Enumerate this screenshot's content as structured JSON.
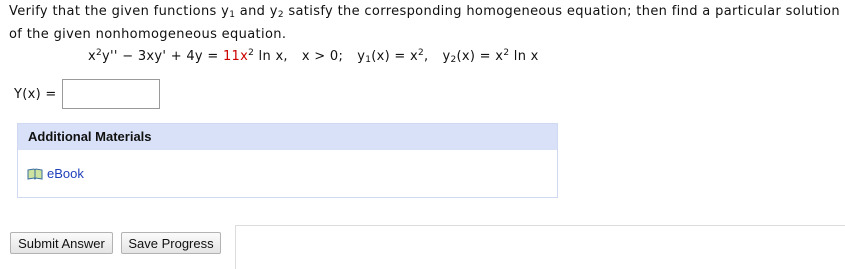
{
  "question": {
    "text_1": "Verify that the given functions ",
    "y1": "y",
    "y1_sub": "1",
    "text_and": " and ",
    "y2": "y",
    "y2_sub": "2",
    "text_2": " satisfy the corresponding homogeneous equation; then find a particular solution of the given nonhomogeneous equation."
  },
  "equation": {
    "lhs_1": "x",
    "lhs_sup": "2",
    "lhs_2": "y'' − 3xy' + 4y = ",
    "rhs_coeff": "11x",
    "rhs_sup": "2",
    "rhs_tail": " ln x,",
    "cond": "x > 0;",
    "y1_label": "y",
    "y1_sub": "1",
    "y1_def": "(x) = x",
    "y1_sup": "2",
    "y1_end": ",",
    "y2_label": "y",
    "y2_sub": "2",
    "y2_def": "(x) = x",
    "y2_sup": "2",
    "y2_end": " ln x"
  },
  "answer": {
    "label": "Y(x)  =",
    "value": ""
  },
  "materials": {
    "header": "Additional Materials",
    "ebook_label": "eBook",
    "icon": "book-icon"
  },
  "buttons": {
    "submit": "Submit Answer",
    "save": "Save Progress"
  },
  "colors": {
    "accent_red": "#cc0000",
    "link_blue": "#1f3fbb",
    "panel_header": "#d8e1f7"
  }
}
